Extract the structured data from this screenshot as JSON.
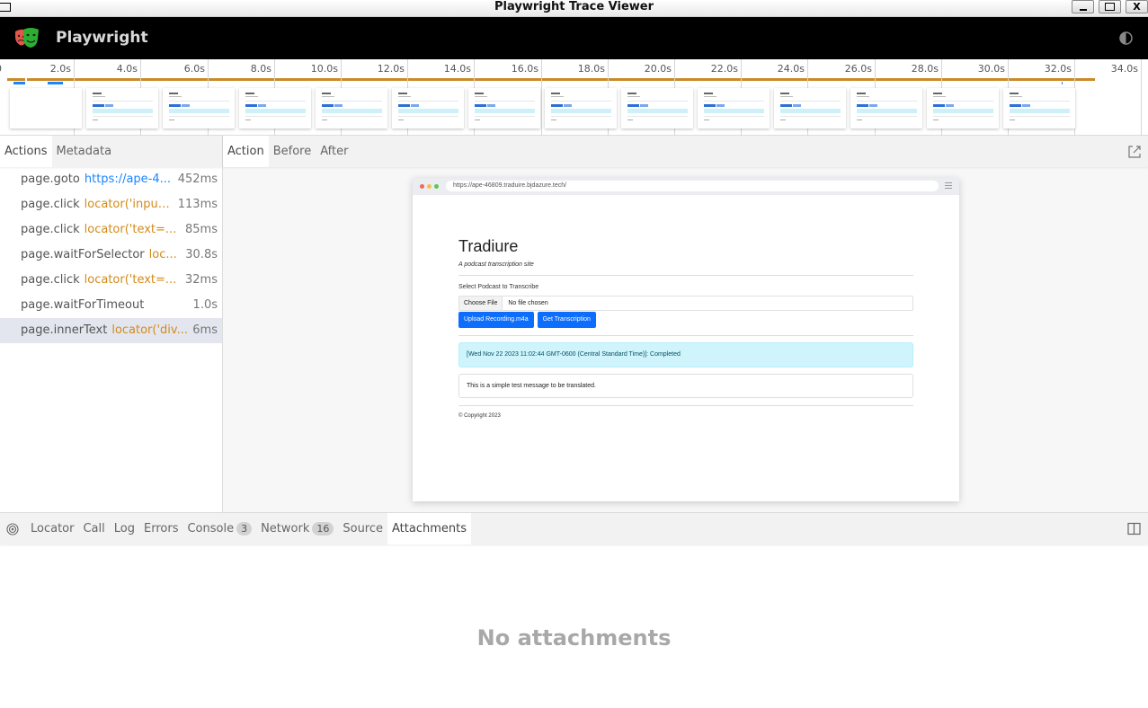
{
  "window": {
    "title": "Playwright Trace Viewer",
    "minimize_label": "_",
    "close_label": "X"
  },
  "header": {
    "app_name": "Playwright",
    "logo_icon": "playwright-masks-logo",
    "theme_toggle_icon": "contrast-icon"
  },
  "timeline": {
    "tick_labels": [
      "0",
      "2.0s",
      "4.0s",
      "6.0s",
      "8.0s",
      "10.0s",
      "12.0s",
      "14.0s",
      "16.0s",
      "18.0s",
      "20.0s",
      "22.0s",
      "24.0s",
      "26.0s",
      "28.0s",
      "30.0s",
      "32.0s",
      "34.0s"
    ],
    "thumbnail_count": 14
  },
  "left_tabs": [
    {
      "label": "Actions",
      "active": true
    },
    {
      "label": "Metadata",
      "active": false
    }
  ],
  "actions": [
    {
      "name": "page.goto",
      "param": "https://ape-4...",
      "param_type": "url",
      "duration": "452ms",
      "selected": false
    },
    {
      "name": "page.click",
      "param": "locator('input...",
      "param_type": "locator",
      "duration": "113ms",
      "selected": false
    },
    {
      "name": "page.click",
      "param": "locator('text=...",
      "param_type": "locator",
      "duration": "85ms",
      "selected": false
    },
    {
      "name": "page.waitForSelector",
      "param": "loc...",
      "param_type": "locator",
      "duration": "30.8s",
      "selected": false
    },
    {
      "name": "page.click",
      "param": "locator('text=...",
      "param_type": "locator",
      "duration": "32ms",
      "selected": false
    },
    {
      "name": "page.waitForTimeout",
      "param": "",
      "param_type": "none",
      "duration": "1.0s",
      "selected": false
    },
    {
      "name": "page.innerText",
      "param": "locator('div...",
      "param_type": "locator",
      "duration": "6ms",
      "selected": true
    }
  ],
  "snapshot_tabs": [
    {
      "label": "Action",
      "active": true
    },
    {
      "label": "Before",
      "active": false
    },
    {
      "label": "After",
      "active": false
    }
  ],
  "snapshot": {
    "url": "https://ape-46809.traduire.bjdazure.tech/",
    "site_title": "Tradiure",
    "tagline": "A podcast transcription site",
    "select_label": "Select Podcast to Transcribe",
    "choose_file": "Choose File",
    "no_file": "No file chosen",
    "upload_button": "Upload Recording.m4a",
    "transcription_button": "Get Transcription",
    "status_message": "[Wed Nov 22 2023 11:02:44 GMT-0600 (Central Standard Time)]: Completed",
    "result_text": "This is a simple test message to be translated.",
    "copyright": "© Copyright 2023"
  },
  "bottom_tabs": [
    {
      "label": "Locator",
      "badge": null,
      "active": false
    },
    {
      "label": "Call",
      "badge": null,
      "active": false
    },
    {
      "label": "Log",
      "badge": null,
      "active": false
    },
    {
      "label": "Errors",
      "badge": null,
      "active": false
    },
    {
      "label": "Console",
      "badge": "3",
      "active": false
    },
    {
      "label": "Network",
      "badge": "16",
      "active": false
    },
    {
      "label": "Source",
      "badge": null,
      "active": false
    },
    {
      "label": "Attachments",
      "badge": null,
      "active": true
    }
  ],
  "attachments": {
    "empty_message": "No attachments"
  },
  "colors": {
    "timeline_bar": "#c98a27",
    "action_marker": "#1a85ff",
    "url_param": "#1a85ff",
    "locator_param": "#d38b1a",
    "selected_row": "#e3e6ee",
    "primary_button": "#0d6efd",
    "alert_bg": "#cff4fc"
  }
}
